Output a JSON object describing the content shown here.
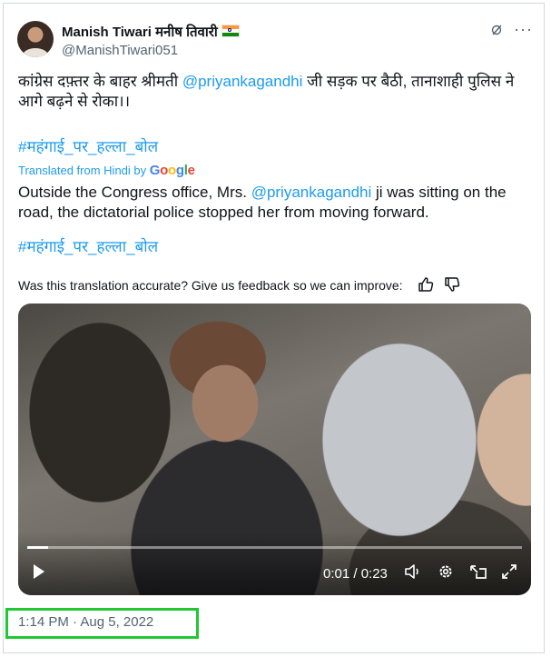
{
  "author": {
    "display_name": "Manish Tiwari मनीष तिवारी",
    "handle": "@ManishTiwari051",
    "flag_icon": "india-flag-icon"
  },
  "header_icons": {
    "grok": "grok-icon",
    "more": "···"
  },
  "tweet": {
    "original_pre": "कांग्रेस दफ़्तर के बाहर श्रीमती ",
    "original_mention": "@priyankagandhi",
    "original_post": " जी सड़क पर बैठी, तानाशाही पुलिस ने आगे बढ़ने से रोका।।",
    "hashtag": "#महंगाई_पर_हल्ला_बोल",
    "translated_from": "Translated from Hindi by ",
    "translator_brand": "Google",
    "brand_colors": [
      "#4285F4",
      "#EA4335",
      "#FBBC05",
      "#4285F4",
      "#34A853",
      "#EA4335"
    ],
    "translation_pre": "Outside the Congress office, Mrs. ",
    "translation_mention": "@priyankagandhi",
    "translation_post": " ji was sitting on the road, the dictatorial police stopped her from moving forward.",
    "hashtag_translated": "#महंगाई_पर_हल्ला_बोल",
    "feedback_prompt": "Was this translation accurate? Give us feedback so we can improve:"
  },
  "video": {
    "current_time": "0:01",
    "duration": "0:23",
    "time_display": "0:01 / 0:23",
    "progress_fraction": 0.043
  },
  "timestamp": "1:14 PM · Aug 5, 2022",
  "colors": {
    "link": "#1d9bf0",
    "secondary": "#536471",
    "highlight": "#22c833"
  }
}
